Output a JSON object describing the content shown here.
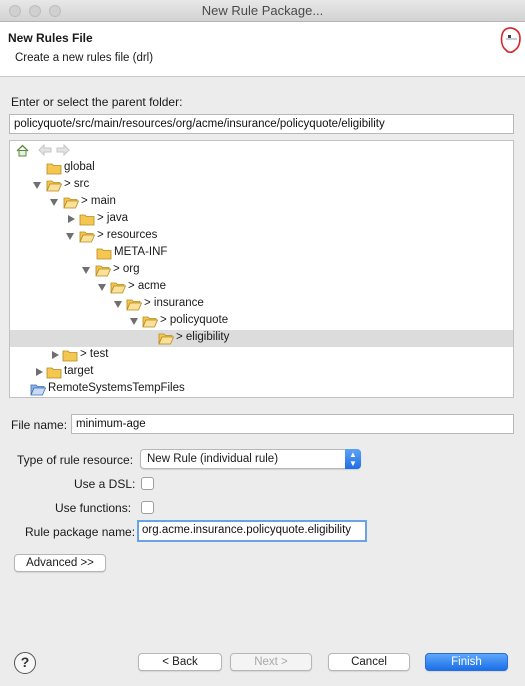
{
  "window": {
    "title": "New Rule Package..."
  },
  "header": {
    "title": "New Rules File",
    "description": "Create a new rules file (drl)"
  },
  "parent_folder": {
    "label": "Enter or select the parent folder:",
    "value": "policyquote/src/main/resources/org/acme/insurance/policyquote/eligibility"
  },
  "tree": {
    "items": [
      {
        "label": "global"
      },
      {
        "label": "> src"
      },
      {
        "label": "> main"
      },
      {
        "label": "> java"
      },
      {
        "label": "> resources"
      },
      {
        "label": "META-INF"
      },
      {
        "label": "> org"
      },
      {
        "label": "> acme"
      },
      {
        "label": "> insurance"
      },
      {
        "label": "> policyquote"
      },
      {
        "label": "> eligibility"
      },
      {
        "label": "> test"
      },
      {
        "label": "target"
      },
      {
        "label": "RemoteSystemsTempFiles"
      }
    ]
  },
  "file_name": {
    "label": "File name:",
    "value": "minimum-age"
  },
  "rule_type": {
    "label": "Type of rule resource:",
    "selected": "New Rule (individual rule)"
  },
  "use_dsl": {
    "label": "Use a DSL:",
    "checked": false
  },
  "use_functions": {
    "label": "Use functions:",
    "checked": false
  },
  "package": {
    "label": "Rule package name:",
    "value": "org.acme.insurance.policyquote.eligibility"
  },
  "buttons": {
    "advanced": "Advanced >>",
    "back": "< Back",
    "next": "Next >",
    "cancel": "Cancel",
    "finish": "Finish",
    "help": "?"
  },
  "colors": {
    "accent": "#1b6fe8",
    "selection": "#dcdcdc",
    "folder": "#f5c650"
  }
}
